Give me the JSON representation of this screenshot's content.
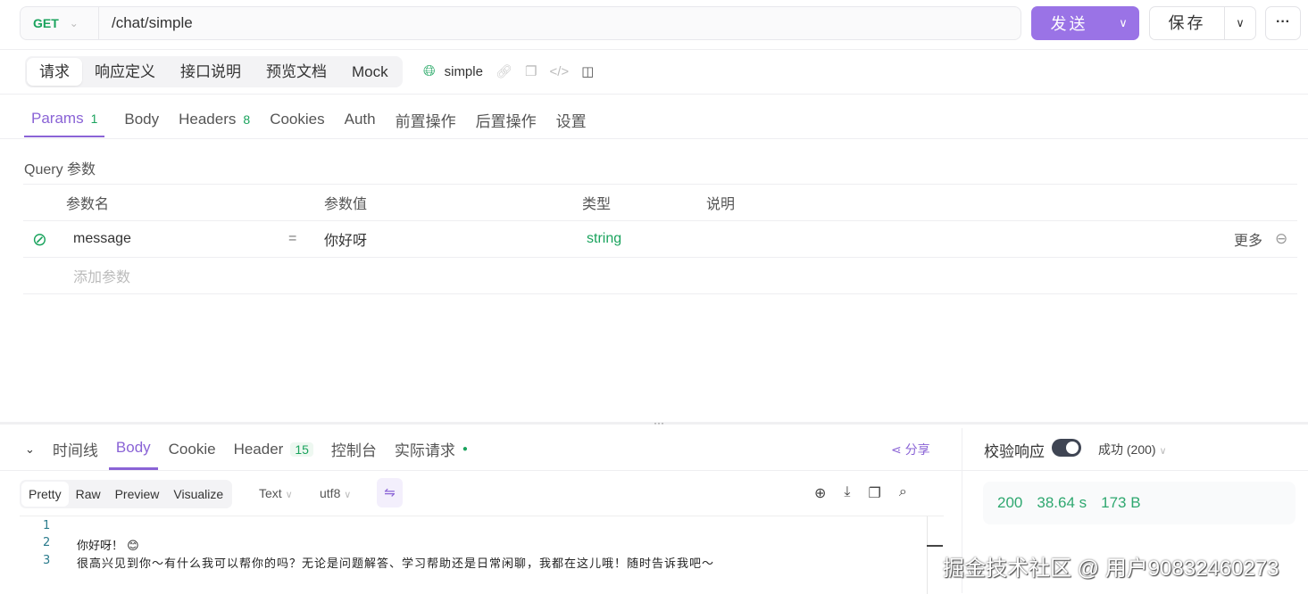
{
  "request": {
    "method": "GET",
    "url": "/chat/simple",
    "send_label": "发送",
    "save_label": "保存"
  },
  "mode_tabs": [
    "请求",
    "响应定义",
    "接口说明",
    "预览文档",
    "Mock"
  ],
  "env_name": "simple",
  "param_tabs": [
    {
      "label": "Params",
      "badge": "1"
    },
    {
      "label": "Body"
    },
    {
      "label": "Headers",
      "badge": "8"
    },
    {
      "label": "Cookies"
    },
    {
      "label": "Auth"
    },
    {
      "label": "前置操作"
    },
    {
      "label": "后置操作"
    },
    {
      "label": "设置"
    }
  ],
  "query": {
    "title": "Query 参数",
    "headers": [
      "参数名",
      "参数值",
      "类型",
      "说明"
    ],
    "rows": [
      {
        "name": "message",
        "eq": "=",
        "value": "你好呀",
        "type": "string",
        "more": "更多"
      }
    ],
    "add_placeholder": "添加参数"
  },
  "response_tabs": [
    {
      "label": "时间线"
    },
    {
      "label": "Body"
    },
    {
      "label": "Cookie"
    },
    {
      "label": "Header",
      "badge": "15"
    },
    {
      "label": "控制台"
    },
    {
      "label": "实际请求"
    }
  ],
  "share_label": "分享",
  "view_modes": [
    "Pretty",
    "Raw",
    "Preview",
    "Visualize"
  ],
  "format": "Text",
  "encoding": "utf8",
  "code_lines": [
    {
      "n": "1",
      "t": ""
    },
    {
      "n": "2",
      "t": "你好呀！ 😊"
    },
    {
      "n": "3",
      "t": "很高兴见到你～有什么我可以帮你的吗？无论是问题解答、学习帮助还是日常闲聊，我都在这儿哦！随时告诉我吧～"
    }
  ],
  "validate": {
    "label": "校验响应",
    "enabled": true,
    "status": "成功 (200)"
  },
  "stats": {
    "code": "200",
    "time": "38.64 s",
    "size": "173 B"
  },
  "watermark": "掘金技术社区 @ 用户90832460273",
  "colors": {
    "accent": "#9a73e6",
    "green": "#1aa35d"
  }
}
